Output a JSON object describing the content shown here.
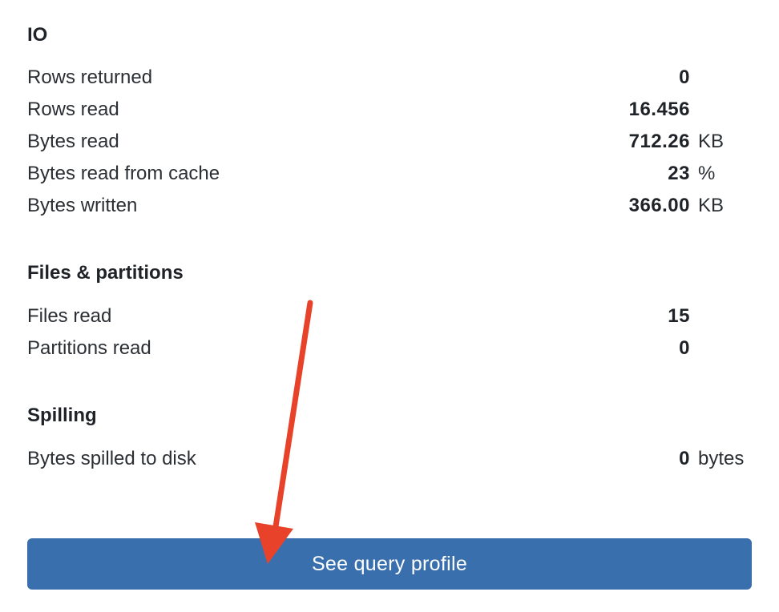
{
  "sections": [
    {
      "title": "IO",
      "rows": [
        {
          "label": "Rows returned",
          "value": "0",
          "unit": ""
        },
        {
          "label": "Rows read",
          "value": "16.456",
          "unit": ""
        },
        {
          "label": "Bytes read",
          "value": "712.26",
          "unit": "KB"
        },
        {
          "label": "Bytes read from cache",
          "value": "23",
          "unit": "%"
        },
        {
          "label": "Bytes written",
          "value": "366.00",
          "unit": "KB"
        }
      ]
    },
    {
      "title": "Files & partitions",
      "rows": [
        {
          "label": "Files read",
          "value": "15",
          "unit": ""
        },
        {
          "label": "Partitions read",
          "value": "0",
          "unit": ""
        }
      ]
    },
    {
      "title": "Spilling",
      "rows": [
        {
          "label": "Bytes spilled to disk",
          "value": "0",
          "unit": "bytes"
        }
      ]
    }
  ],
  "button": {
    "label": "See query profile"
  },
  "colors": {
    "button": "#3a6fae",
    "annotation_arrow": "#e8432a"
  }
}
